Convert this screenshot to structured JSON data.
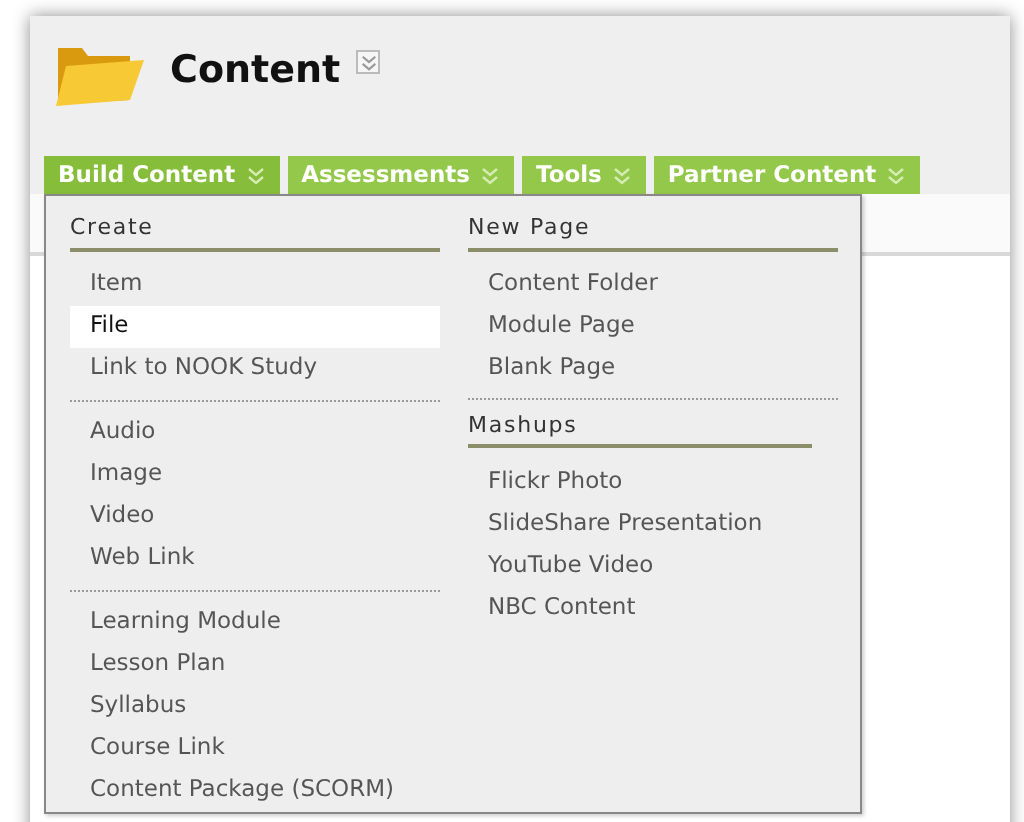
{
  "page": {
    "title": "Content"
  },
  "tabs": [
    {
      "label": "Build Content",
      "selected": true
    },
    {
      "label": "Assessments",
      "selected": false
    },
    {
      "label": "Tools",
      "selected": false
    },
    {
      "label": "Partner Content",
      "selected": false
    }
  ],
  "menu": {
    "columns": [
      {
        "sections": [
          {
            "heading": "Create",
            "groups": [
              [
                {
                  "label": "Item",
                  "selected": false
                },
                {
                  "label": "File",
                  "selected": true
                },
                {
                  "label": "Link to NOOK Study",
                  "selected": false
                }
              ],
              [
                {
                  "label": "Audio",
                  "selected": false
                },
                {
                  "label": "Image",
                  "selected": false
                },
                {
                  "label": "Video",
                  "selected": false
                },
                {
                  "label": "Web Link",
                  "selected": false
                }
              ],
              [
                {
                  "label": "Learning Module",
                  "selected": false
                },
                {
                  "label": "Lesson Plan",
                  "selected": false
                },
                {
                  "label": "Syllabus",
                  "selected": false
                },
                {
                  "label": "Course Link",
                  "selected": false
                },
                {
                  "label": "Content Package (SCORM)",
                  "selected": false
                }
              ]
            ]
          }
        ]
      },
      {
        "sections": [
          {
            "heading": "New Page",
            "groups": [
              [
                {
                  "label": "Content Folder",
                  "selected": false
                },
                {
                  "label": "Module Page",
                  "selected": false
                },
                {
                  "label": "Blank Page",
                  "selected": false
                }
              ]
            ]
          },
          {
            "heading": "Mashups",
            "groups": [
              [
                {
                  "label": "Flickr Photo",
                  "selected": false
                },
                {
                  "label": "SlideShare Presentation",
                  "selected": false
                },
                {
                  "label": "YouTube Video",
                  "selected": false
                },
                {
                  "label": "NBC Content",
                  "selected": false
                }
              ]
            ]
          }
        ]
      }
    ]
  }
}
